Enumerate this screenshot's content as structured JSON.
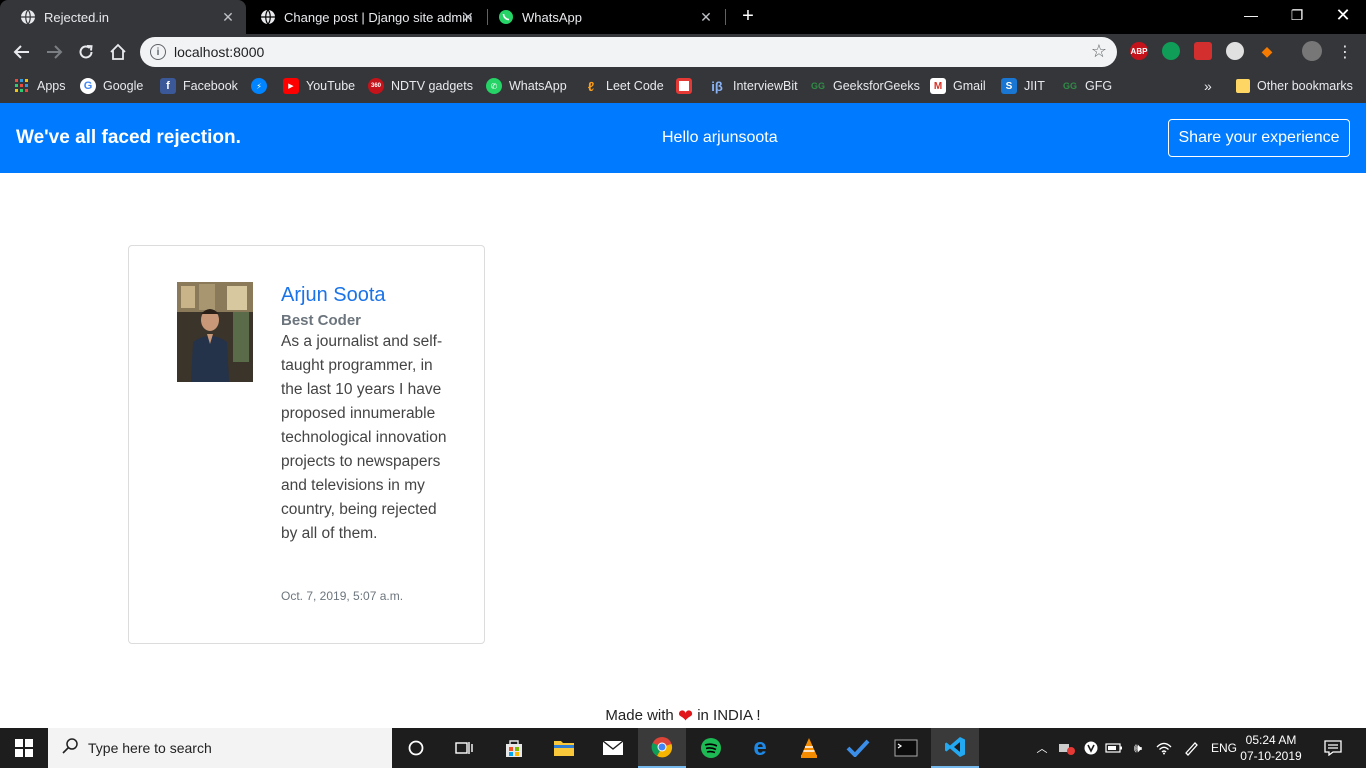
{
  "browser": {
    "tabs": [
      {
        "title": "Rejected.in",
        "active": true
      },
      {
        "title": "Change post | Django site admin",
        "active": false
      },
      {
        "title": "WhatsApp",
        "active": false
      }
    ],
    "url": "localhost:8000",
    "bookmarks": [
      "Apps",
      "Google",
      "Facebook",
      "YouTube",
      "NDTV gadgets",
      "WhatsApp",
      "Leet Code",
      "InterviewBit",
      "GeeksforGeeks",
      "Gmail",
      "JIIT",
      "GFG"
    ],
    "other_bookmarks": "Other bookmarks",
    "extensions": [
      "ABP"
    ],
    "more_bookmarks": "»"
  },
  "page": {
    "brand": "We've all faced rejection.",
    "greeting": "Hello arjunsoota",
    "share_button": "Share your experience",
    "post": {
      "author": "Arjun Soota",
      "role": "Best Coder",
      "body": "As a journalist and self-taught programmer, in the last 10 years I have proposed innumerable technological innovation projects to newspapers and televisions in my country, being rejected by all of them.",
      "timestamp": "Oct. 7, 2019, 5:07 a.m."
    },
    "footer": {
      "before": "Made with",
      "after": "in INDIA !"
    }
  },
  "taskbar": {
    "search_placeholder": "Type here to search",
    "language": "ENG",
    "time": "05:24 AM",
    "date": "07-10-2019"
  },
  "colors": {
    "navbar": "#007bff",
    "link": "#1a73e8",
    "heart": "#e0161b"
  }
}
